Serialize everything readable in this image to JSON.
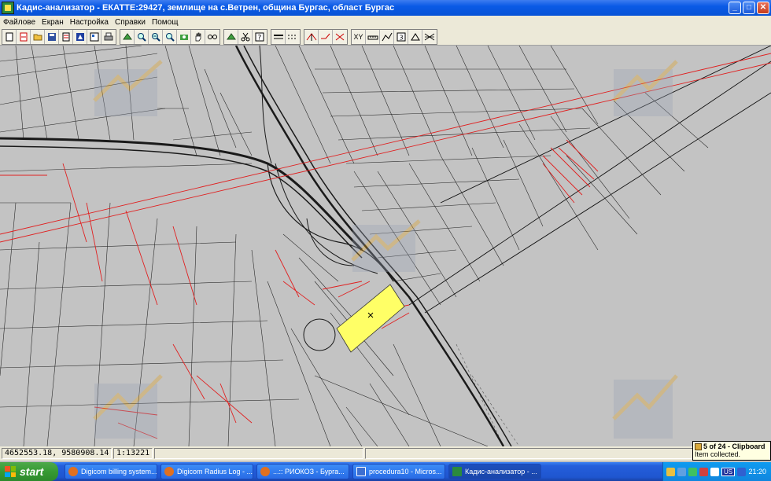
{
  "window": {
    "title": "Кадис-анализатор - ЕКАТТЕ:29427, землище на с.Ветрен, община Бургас, област Бургас",
    "buttons": {
      "minimize": "_",
      "maximize": "□",
      "close": "✕"
    }
  },
  "menu": [
    "Файлове",
    "Екран",
    "Настройка",
    "Справки",
    "Помощ"
  ],
  "toolbar": {
    "groups": [
      [
        "new-icon",
        "open-icon",
        "folder-icon",
        "save-icon",
        "document-icon",
        "layers-icon",
        "properties-icon",
        "print-icon"
      ],
      [
        "select-icon",
        "zoom-in-icon",
        "zoom-out-icon",
        "zoom-window-icon",
        "zoom-all-icon",
        "pan-hand-icon",
        "glasses-icon"
      ],
      [
        "pointer-icon",
        "scissors-icon",
        "help-icon"
      ],
      [
        "line-icon",
        "dashed-line-icon"
      ],
      [
        "measure-angle-icon",
        "cut-line-icon",
        "cross-icon"
      ],
      [
        "xy-icon",
        "measure-icon",
        "polyline-icon",
        "number-icon",
        "triangle-icon",
        "polygon-icon"
      ]
    ],
    "xy_label": "XY"
  },
  "status": {
    "coordinates": "4652553.18, 9580908.14",
    "scale": "1:13221",
    "field3": "",
    "field4": ""
  },
  "clipboard": {
    "title": "5 of 24 - Clipboard",
    "message": "Item collected."
  },
  "taskbar": {
    "start_label": "start",
    "tasks": [
      {
        "label": "Digicom billing system...",
        "icon": "firefox"
      },
      {
        "label": "Digicom Radius Log - ...",
        "icon": "firefox"
      },
      {
        "label": "...:: РИОКОЗ - Бурга...",
        "icon": "firefox"
      },
      {
        "label": "procedura10 - Micros...",
        "icon": "word"
      },
      {
        "label": "Кадис-анализатор - ...",
        "icon": "app"
      }
    ],
    "tray_lang": "US",
    "clock": "21:20"
  },
  "colors": {
    "map_bg": "#c3c3c3",
    "parcel_highlight": "#ffff66",
    "red_line": "#e03030",
    "road": "#202020"
  }
}
